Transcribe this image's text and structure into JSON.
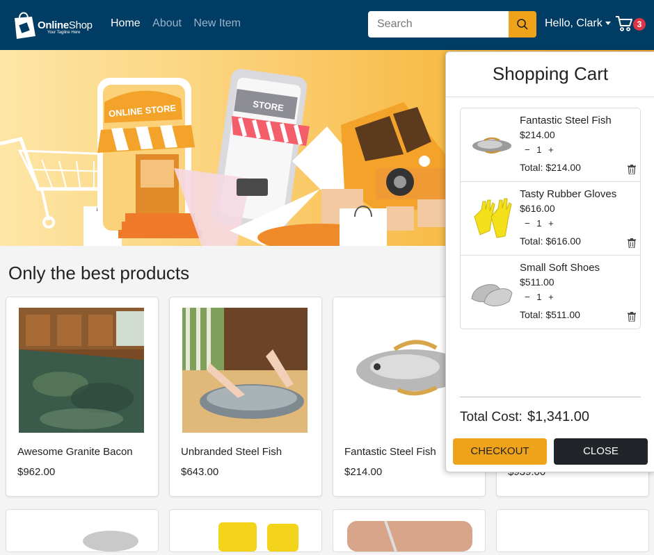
{
  "brand": {
    "name_bold": "Online",
    "name_thin": "Shop",
    "tagline": "Your Tagline Here"
  },
  "nav": {
    "items": [
      {
        "label": "Home"
      },
      {
        "label": "About"
      },
      {
        "label": "New Item"
      }
    ]
  },
  "search": {
    "placeholder": "Search"
  },
  "user": {
    "greeting": "Hello, Clark"
  },
  "cart_badge": {
    "count": "3"
  },
  "hero": {
    "store_sign": "ONLINE STORE",
    "phone_sign": "STORE"
  },
  "section": {
    "title": "Only the best products"
  },
  "products": [
    {
      "name": "Awesome Granite Bacon",
      "price": "$962.00"
    },
    {
      "name": "Unbranded Steel Fish",
      "price": "$643.00"
    },
    {
      "name": "Fantastic Steel Fish",
      "price": "$214.00"
    },
    {
      "name": "",
      "price": "$939.00"
    }
  ],
  "cart": {
    "title": "Shopping Cart",
    "minus": "−",
    "plus": "+",
    "items": [
      {
        "name": "Fantastic Steel Fish",
        "price": "$214.00",
        "qty": "1",
        "total": "Total: $214.00"
      },
      {
        "name": "Tasty Rubber Gloves",
        "price": "$616.00",
        "qty": "1",
        "total": "Total: $616.00"
      },
      {
        "name": "Small Soft Shoes",
        "price": "$511.00",
        "qty": "1",
        "total": "Total: $511.00"
      }
    ],
    "total_label": "Total Cost:",
    "total_value": "$1,341.00",
    "checkout_label": "CHECKOUT",
    "close_label": "CLOSE"
  },
  "colors": {
    "navbar": "#003c64",
    "accent": "#efa31b",
    "badge": "#dc3545",
    "dark_button": "#212529"
  }
}
